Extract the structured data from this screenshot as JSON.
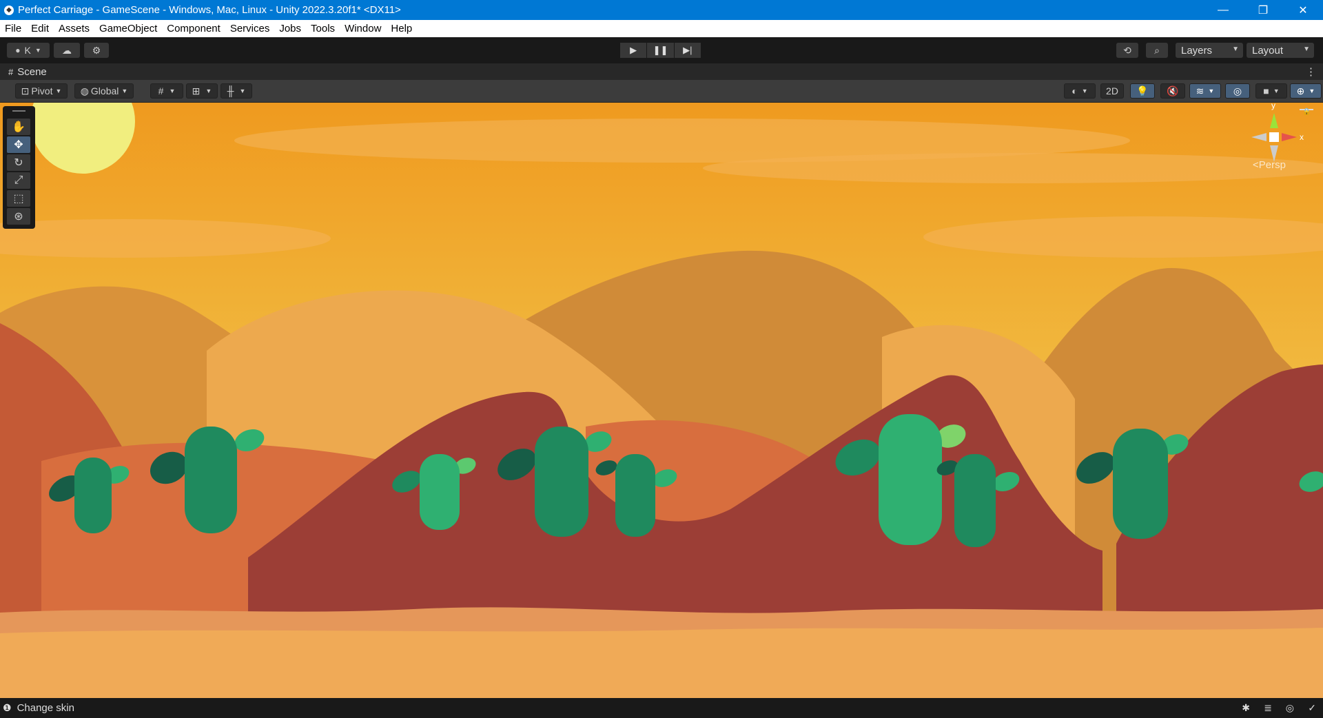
{
  "window": {
    "title": "Perfect Carriage - GameScene - Windows, Mac, Linux - Unity 2022.3.20f1* <DX11>",
    "controls": [
      "—",
      "❐",
      "✕"
    ]
  },
  "menu": [
    "File",
    "Edit",
    "Assets",
    "GameObject",
    "Component",
    "Services",
    "Jobs",
    "Tools",
    "Window",
    "Help"
  ],
  "toolbar": {
    "account_label": "K",
    "layers_label": "Layers",
    "layout_label": "Layout",
    "play_icon": "play-icon",
    "pause_icon": "pause-icon",
    "step_icon": "step-icon"
  },
  "scene_tab": {
    "label": "Scene"
  },
  "scene_toolbar": {
    "pivot_label": "Pivot",
    "global_label": "Global",
    "mode_2d_label": "2D"
  },
  "gizmo": {
    "y": "y",
    "x": "x",
    "persp": "<Persp"
  },
  "status": {
    "text": "Change skin"
  },
  "colors": {
    "accent_blue": "#0078d4",
    "selected_tool": "#46607c",
    "sky_top": "#ef9a1f",
    "sky_bottom": "#f2c04a",
    "sun": "#f1ee7f",
    "dune_red": "#9c3e36",
    "cactus_green": "#1f8a5e"
  }
}
